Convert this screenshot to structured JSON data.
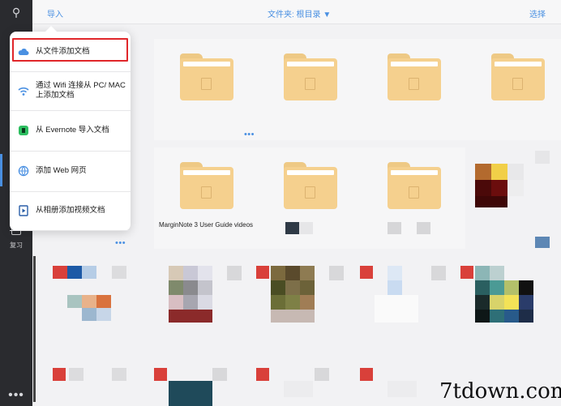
{
  "topbar": {
    "import_label": "导入",
    "folder_label": "文件夹: 根目录 ▼",
    "select_label": "选择"
  },
  "sidebar": {
    "search_icon": "⚲",
    "review_label": "复习",
    "more_icon": "•••"
  },
  "import_menu": {
    "items": [
      {
        "label": "从文件添加文档",
        "icon": "cloud-icon"
      },
      {
        "label": "通过 Wifi 连接从 PC/ MAC 上添加文档",
        "icon": "wifi-icon"
      },
      {
        "label": "从 Evernote 导入文档",
        "icon": "evernote-icon"
      },
      {
        "label": "添加 Web 网页",
        "icon": "globe-icon"
      },
      {
        "label": "从相册添加视频文档",
        "icon": "video-icon"
      }
    ]
  },
  "folders": [
    {
      "caption": ""
    },
    {
      "caption": ""
    },
    {
      "caption": ""
    },
    {
      "caption": ""
    },
    {
      "caption": ""
    },
    {
      "caption": "MarginNote 3 User Guide videos"
    },
    {
      "caption": ""
    }
  ],
  "more_label": "•••",
  "watermark": "7tdown.com",
  "colors": {
    "accent": "#4a90e2",
    "highlight": "#e0262a",
    "folder": "#f5d08e"
  }
}
